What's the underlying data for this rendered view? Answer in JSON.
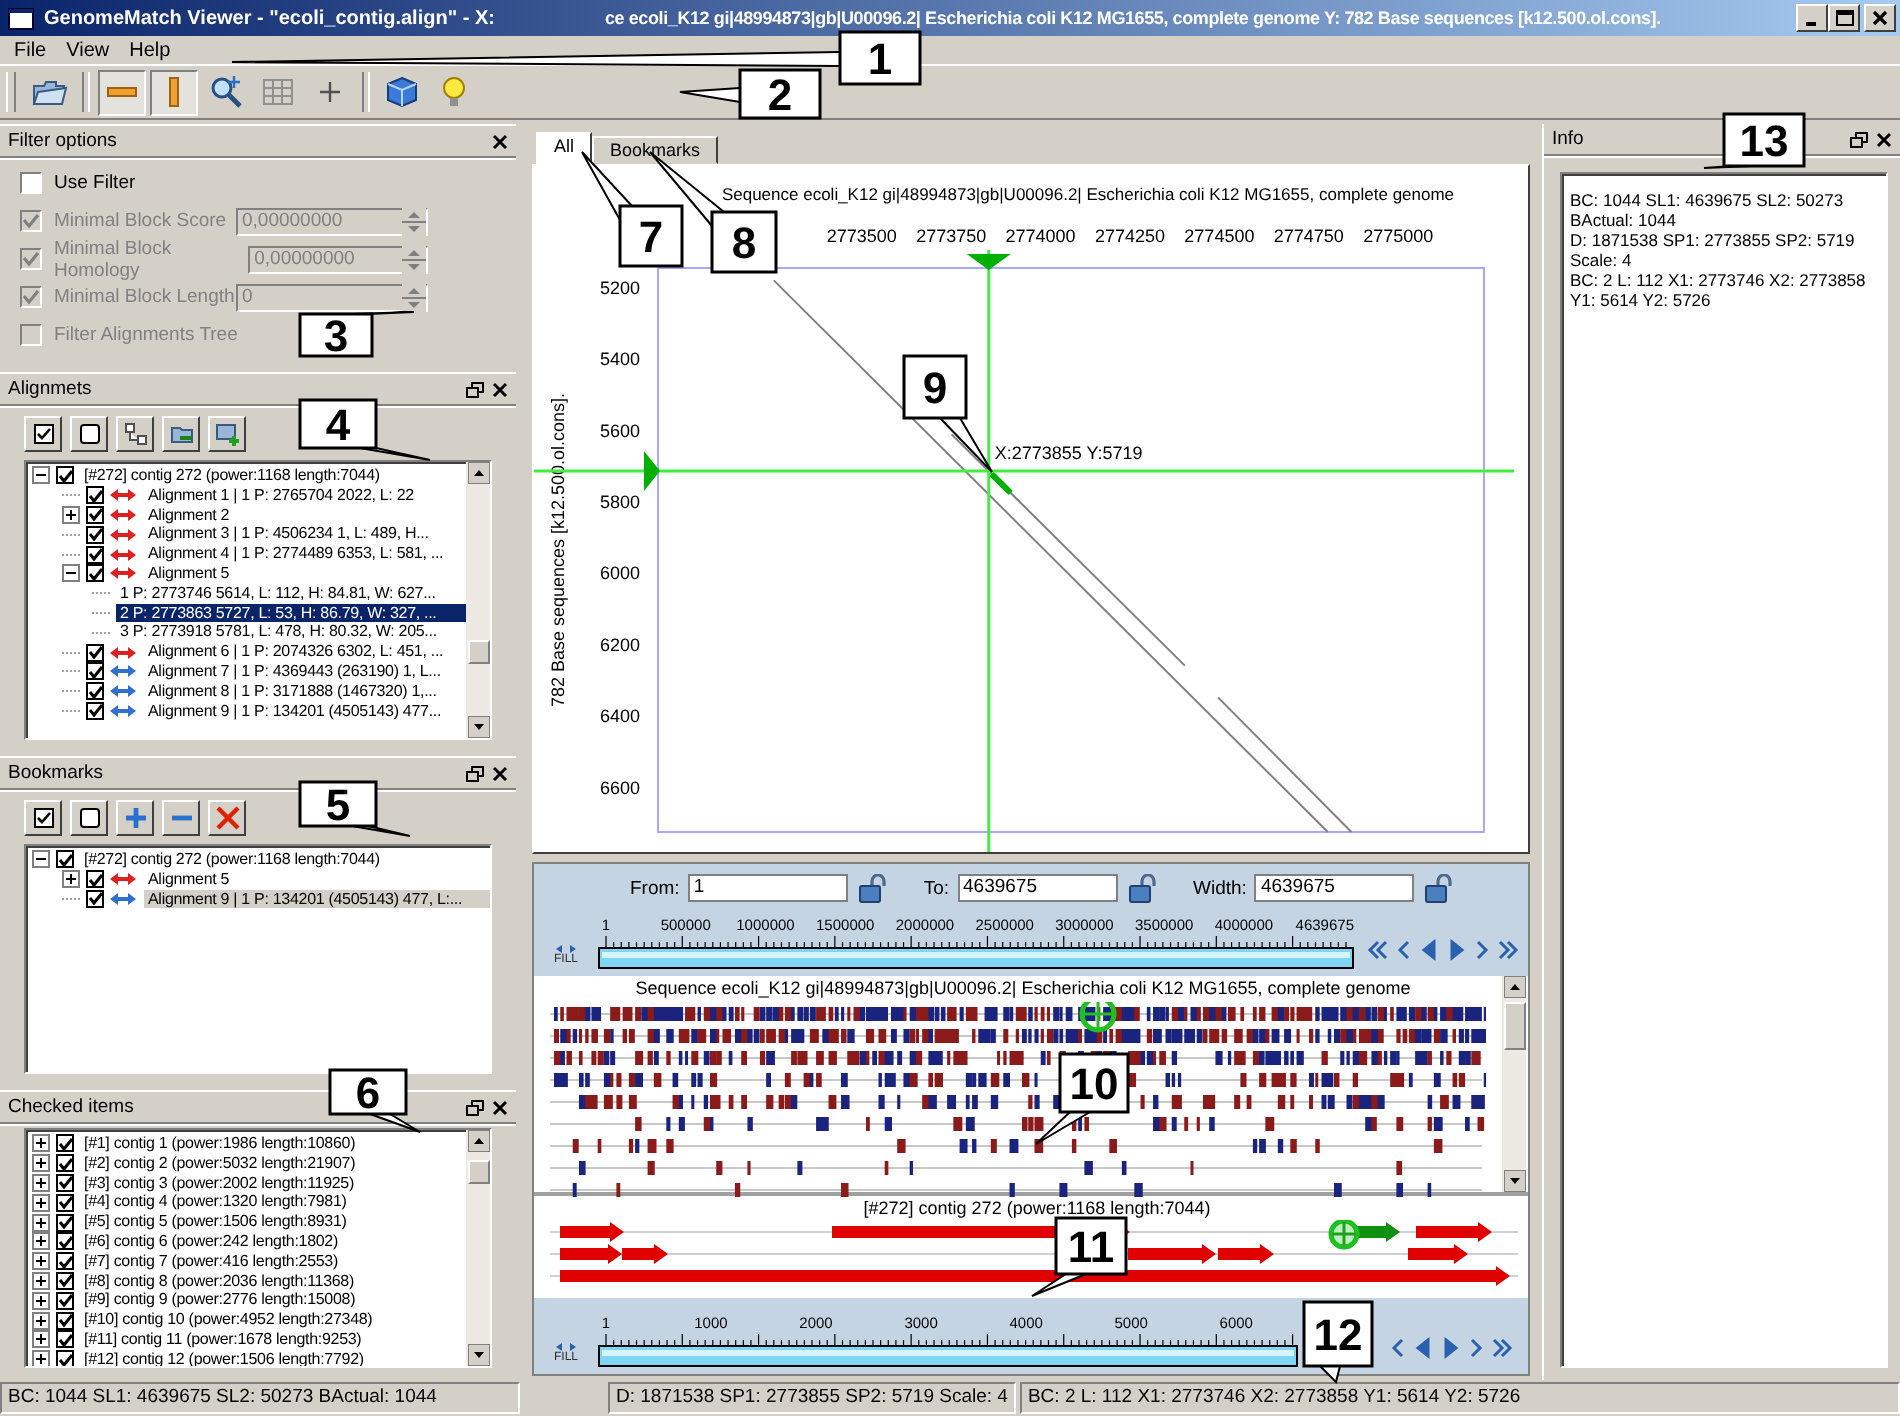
{
  "window": {
    "title_parts": [
      "GenomeMatch Viewer - \"ecoli_contig.align\" - X:",
      "ce ecoli_K12 gi|48994873|gb|U00096.2| Escherichia coli K12 MG1655, complete genome  Y: 782 Base sequences [k12.500.ol.cons]."
    ]
  },
  "menu": [
    "File",
    "View",
    "Help"
  ],
  "toolbar": [
    {
      "kind": "folder",
      "pressed": false
    },
    {
      "kind": "hbar",
      "pressed": true
    },
    {
      "kind": "vbar",
      "pressed": true
    },
    {
      "kind": "zoom",
      "pressed": false
    },
    {
      "kind": "grid",
      "pressed": false
    },
    {
      "kind": "plus",
      "pressed": false
    },
    {
      "kind": "cube",
      "pressed": false
    },
    {
      "kind": "bulb",
      "pressed": false
    }
  ],
  "filter": {
    "title": "Filter options",
    "options": [
      {
        "label": "Use Filter",
        "checked": false,
        "disabled": false
      },
      {
        "label": "Minimal Block Score",
        "checked": true,
        "disabled": true,
        "value": "0,00000000"
      },
      {
        "label": "Minimal Block Homology",
        "checked": true,
        "disabled": true,
        "value": "0,00000000"
      },
      {
        "label": "Minimal Block Length",
        "checked": true,
        "disabled": true,
        "value": "0"
      },
      {
        "label": "Filter Alignments Tree",
        "checked": false,
        "disabled": true
      }
    ]
  },
  "alignments": {
    "title": "Alignmets",
    "focused": true,
    "tools": [
      {
        "kind": "check"
      },
      {
        "kind": "uncheck"
      },
      {
        "kind": "tree"
      },
      {
        "kind": "folder-remove"
      },
      {
        "kind": "add-view"
      }
    ],
    "tree": [
      {
        "kind": "contig",
        "label": "[#272] contig 272 (power:1168 length:7044)",
        "checked": true,
        "expanded": true,
        "selected": false,
        "children": [
          {
            "kind": "alignment",
            "label": "Alignment 1 | 1 P: 2765704 2022, L: 22",
            "checked": true,
            "selected": false,
            "color": "#e02020"
          },
          {
            "kind": "alignment",
            "label": "Alignment 2",
            "checked": true,
            "expanded": false,
            "selected": false,
            "color": "#e02020"
          },
          {
            "kind": "alignment",
            "label": "Alignment 3 | 1 P: 4506234 1, L: 489, H...",
            "checked": true,
            "selected": false,
            "color": "#e02020"
          },
          {
            "kind": "alignment",
            "label": "Alignment 4 | 1 P: 2774489 6353, L: 581, ...",
            "checked": true,
            "selected": false,
            "color": "#e02020"
          },
          {
            "kind": "alignment",
            "label": "Alignment 5",
            "checked": true,
            "expanded": true,
            "selected": false,
            "color": "#e02020",
            "children": [
              {
                "kind": "hit",
                "label": "1 P: 2773746 5614, L: 112, H: 84.81, W: 627...",
                "selected": false
              },
              {
                "kind": "hit",
                "label": "2 P: 2773863 5727, L: 53, H: 86.79, W: 327, ...",
                "selected": true
              },
              {
                "kind": "hit",
                "label": "3 P: 2773918 5781, L: 478, H: 80.32, W: 205...",
                "selected": false
              }
            ]
          },
          {
            "kind": "alignment",
            "label": "Alignment 6 | 1 P: 2074326 6302, L: 451, ...",
            "checked": true,
            "selected": false,
            "color": "#e02020"
          },
          {
            "kind": "alignment",
            "label": "Alignment 7 | 1 P: 4369443 (263190) 1, L...",
            "checked": true,
            "selected": false,
            "color": "#3070d0"
          },
          {
            "kind": "alignment",
            "label": "Alignment 8 | 1 P: 3171888 (1467320) 1,...",
            "checked": true,
            "selected": false,
            "color": "#3070d0"
          },
          {
            "kind": "alignment",
            "label": "Alignment 9 | 1 P: 134201 (4505143) 477...",
            "checked": true,
            "selected": false,
            "color": "#3070d0"
          }
        ]
      }
    ]
  },
  "bookmarks": {
    "title": "Bookmarks",
    "focused": false,
    "tools": [
      {
        "kind": "check"
      },
      {
        "kind": "uncheck"
      },
      {
        "kind": "add"
      },
      {
        "kind": "remove"
      },
      {
        "kind": "delete"
      }
    ],
    "tree": [
      {
        "kind": "contig",
        "label": "[#272] contig 272 (power:1168 length:7044)",
        "checked": true,
        "expanded": true,
        "selected": false,
        "children": [
          {
            "kind": "alignment",
            "label": "Alignment 5",
            "checked": true,
            "expanded": false,
            "selected": false,
            "color": "#e02020"
          },
          {
            "kind": "alignment",
            "label": "Alignment 9 | 1 P: 134201 (4505143) 477, L:...",
            "checked": true,
            "selected": true,
            "color": "#3070d0"
          }
        ]
      }
    ]
  },
  "checked_items": {
    "title": "Checked items",
    "tree": [
      {
        "kind": "contig",
        "label": "[#1] contig 1 (power:1986 length:10860)",
        "checked": true,
        "expanded": false
      },
      {
        "kind": "contig",
        "label": "[#2] contig 2 (power:5032 length:21907)",
        "checked": true,
        "expanded": false
      },
      {
        "kind": "contig",
        "label": "[#3] contig 3 (power:2002 length:11925)",
        "checked": true,
        "expanded": false
      },
      {
        "kind": "contig",
        "label": "[#4] contig 4 (power:1320 length:7981)",
        "checked": true,
        "expanded": false
      },
      {
        "kind": "contig",
        "label": "[#5] contig 5 (power:1506 length:8931)",
        "checked": true,
        "expanded": false
      },
      {
        "kind": "contig",
        "label": "[#6] contig 6 (power:242 length:1802)",
        "checked": true,
        "expanded": false
      },
      {
        "kind": "contig",
        "label": "[#7] contig 7 (power:416 length:2553)",
        "checked": true,
        "expanded": false
      },
      {
        "kind": "contig",
        "label": "[#8] contig 8 (power:2036 length:11368)",
        "checked": true,
        "expanded": false
      },
      {
        "kind": "contig",
        "label": "[#9] contig 9 (power:2776 length:15008)",
        "checked": true,
        "expanded": false
      },
      {
        "kind": "contig",
        "label": "[#10] contig 10 (power:4952 length:27348)",
        "checked": true,
        "expanded": false
      },
      {
        "kind": "contig",
        "label": "[#11] contig 11 (power:1678 length:9253)",
        "checked": true,
        "expanded": false
      },
      {
        "kind": "contig",
        "label": "[#12] contig 12 (power:1506 length:7792)",
        "checked": true,
        "expanded": false
      }
    ]
  },
  "view": {
    "tabs": [
      {
        "label": "All",
        "selected": true
      },
      {
        "label": "Bookmarks",
        "selected": false
      }
    ],
    "chart_data": {
      "type": "line",
      "title": "Sequence ecoli_K12 gi|48994873|gb|U00096.2| Escherichia coli K12 MG1655, complete genome",
      "ylabel": "782 Base sequences [k12.500.ol.cons].",
      "xlim": [
        2772930,
        2775240
      ],
      "ylim": [
        6730,
        5150
      ],
      "xticks": [
        2773500,
        2773750,
        2774000,
        2774250,
        2774500,
        2774750,
        2775000
      ],
      "yticks": [
        5200,
        5400,
        5600,
        5800,
        6000,
        6200,
        6400,
        6600
      ],
      "series": [
        {
          "color": "#808080",
          "x": [
            2773254,
            2774803
          ],
          "values": [
            5185,
            6730
          ]
        },
        {
          "color": "#808080",
          "x": [
            2773751,
            2774403
          ],
          "values": [
            5616,
            6264
          ]
        },
        {
          "color": "#808080",
          "x": [
            2774496,
            2774869
          ],
          "values": [
            6353,
            6730
          ]
        },
        {
          "color": "#00b000",
          "x": [
            2773863,
            2773916
          ],
          "values": [
            5727,
            5780
          ]
        }
      ],
      "ref_lines": [
        {
          "axis": "x",
          "value": 2773855,
          "color": "#40f040"
        },
        {
          "axis": "y",
          "value": 5719,
          "color": "#40f040"
        }
      ],
      "annotations": [
        {
          "x": 2773855,
          "y": 5719,
          "text": "X:2773855 Y:5719"
        }
      ]
    }
  },
  "tracks": {
    "from": {
      "label": "From:",
      "value": "1"
    },
    "to": {
      "label": "To:",
      "value": "4639675"
    },
    "width": {
      "label": "Width:",
      "value": "4639675"
    },
    "fill_label": "FILL",
    "ruler": [
      "1",
      "500000",
      "1000000",
      "1500000",
      "2000000",
      "2500000",
      "3000000",
      "3500000",
      "4000000",
      "4639675"
    ],
    "sequence_title": "Sequence ecoli_K12 gi|48994873|gb|U00096.2| Escherichia coli K12 MG1655, complete genome",
    "contig_title": "[#272] contig 272 (power:1168 length:7044)",
    "contig_ruler": [
      "1",
      "1000",
      "2000",
      "3000",
      "4000",
      "5000",
      "6000"
    ],
    "contig_fill_label": "FILL"
  },
  "info": {
    "title": "Info",
    "lines": [
      "BC: 1044 SL1: 4639675 SL2: 50273",
      "BActual: 1044",
      "D: 1871538 SP1: 2773855 SP2: 5719",
      "Scale: 4",
      "BC: 2 L: 112 X1: 2773746 X2: 2773858",
      "Y1: 5614 Y2: 5726"
    ]
  },
  "status_bar": [
    "BC: 1044 SL1: 4639675 SL2: 50273 BActual: 1044",
    "D: 1871538 SP1: 2773855 SP2: 5719 Scale: 4",
    "BC: 2 L: 112 X1: 2773746 X2: 2773858 Y1: 5614 Y2: 5726"
  ],
  "callouts": [
    "1",
    "2",
    "3",
    "4",
    "5",
    "6",
    "7",
    "8",
    "9",
    "10",
    "11",
    "12",
    "13"
  ]
}
